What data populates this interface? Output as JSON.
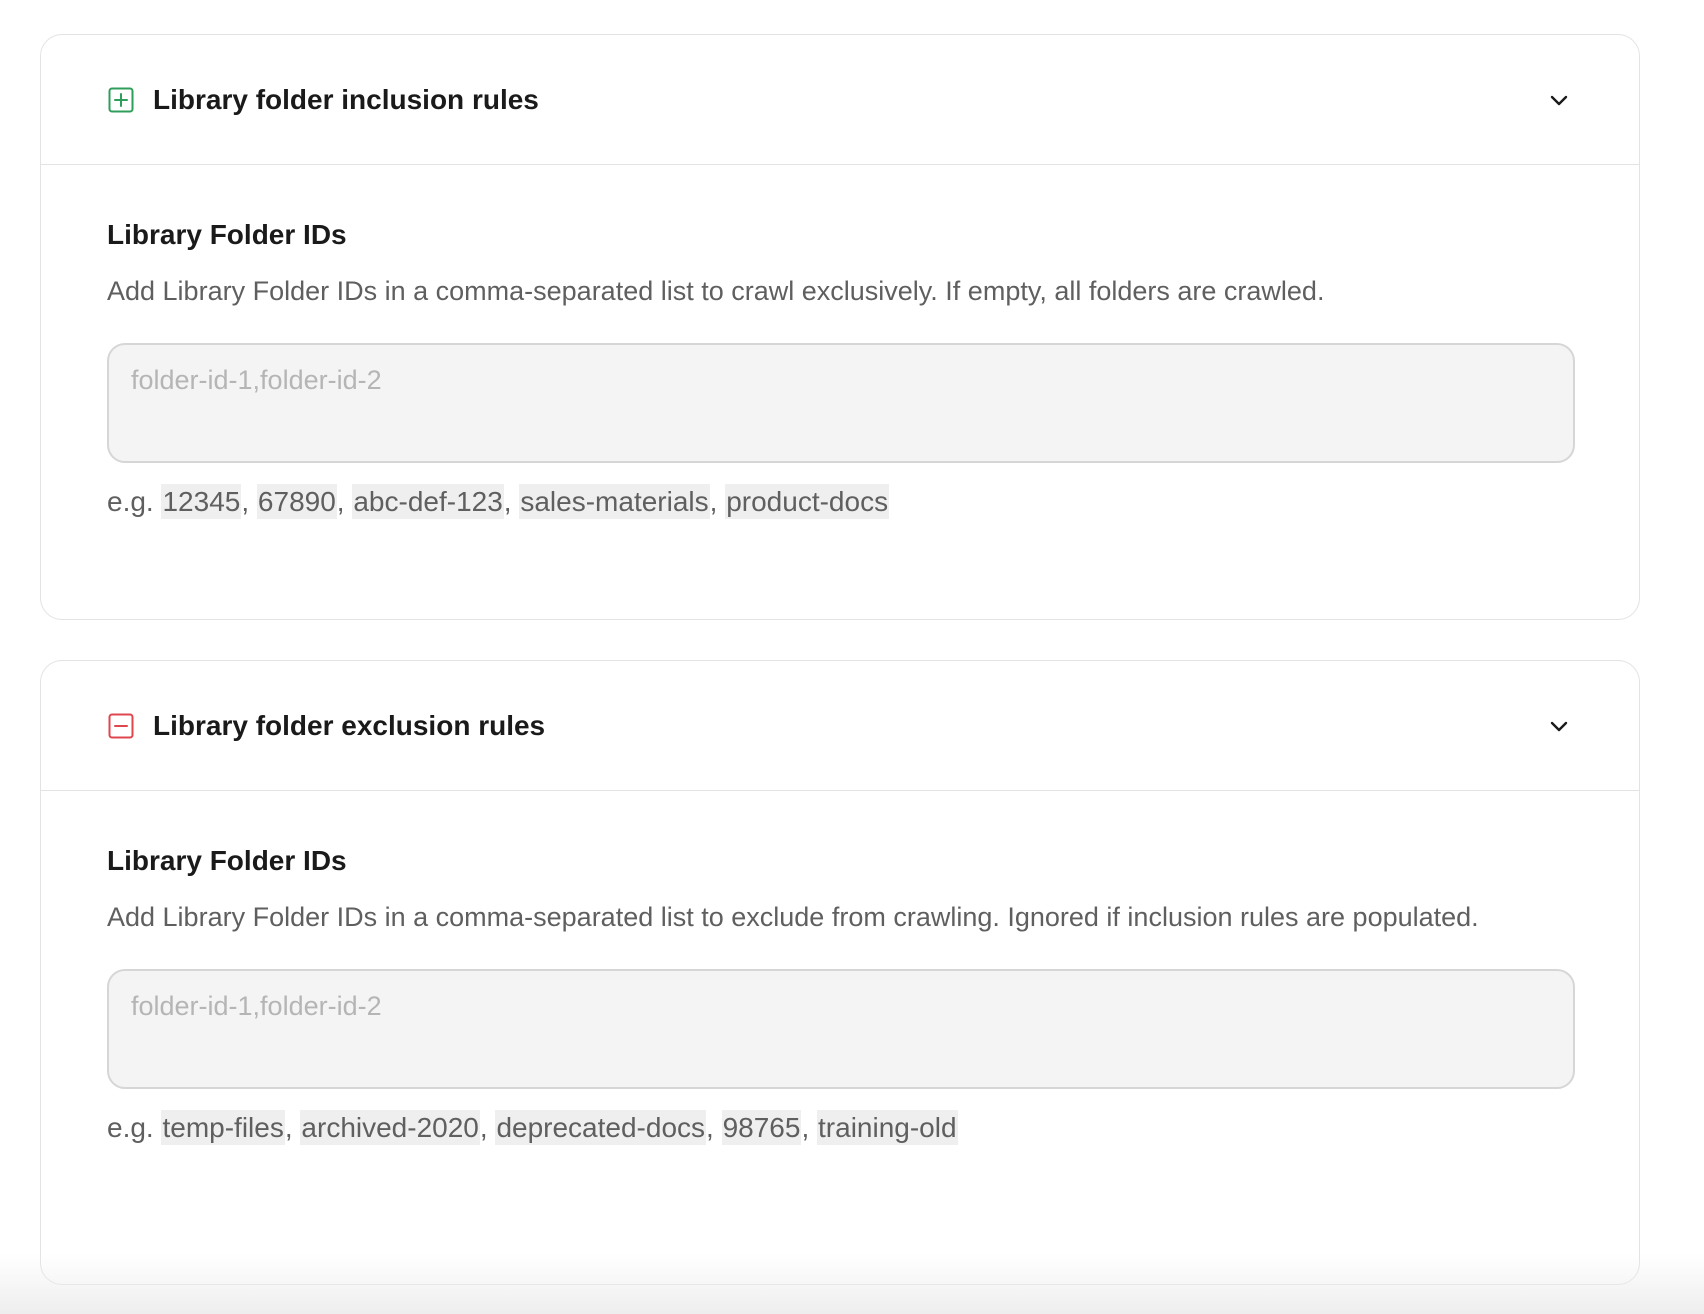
{
  "colors": {
    "inclusion_icon": "#2f9e5b",
    "exclusion_icon": "#e0474c"
  },
  "inclusion": {
    "icon": "plus-square-icon",
    "title": "Library folder inclusion rules",
    "field_label": "Library Folder IDs",
    "description": "Add Library Folder IDs in a comma-separated list to crawl exclusively. If empty, all folders are crawled.",
    "input_value": "",
    "placeholder": "folder-id-1,folder-id-2",
    "examples_prefix": "e.g.",
    "examples": [
      "12345",
      "67890",
      "abc-def-123",
      "sales-materials",
      "product-docs"
    ]
  },
  "exclusion": {
    "icon": "minus-square-icon",
    "title": "Library folder exclusion rules",
    "field_label": "Library Folder IDs",
    "description": "Add Library Folder IDs in a comma-separated list to exclude from crawling. Ignored if inclusion rules are populated.",
    "input_value": "",
    "placeholder": "folder-id-1,folder-id-2",
    "examples_prefix": "e.g.",
    "examples": [
      "temp-files",
      "archived-2020",
      "deprecated-docs",
      "98765",
      "training-old"
    ]
  }
}
